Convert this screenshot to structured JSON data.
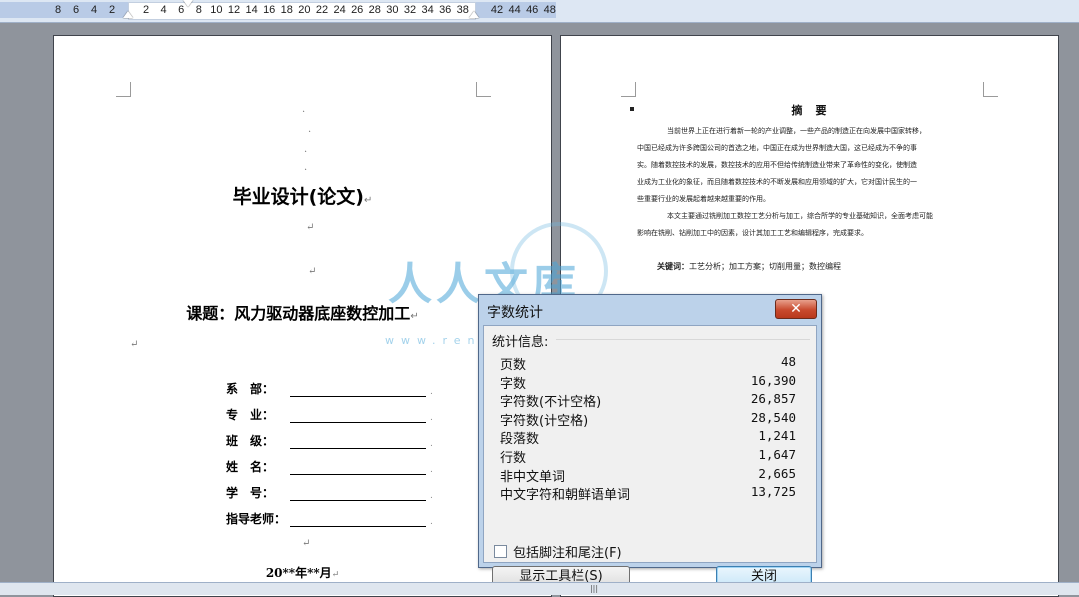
{
  "ruler": {
    "numbers_left": [
      "8",
      "6",
      "4",
      "2"
    ],
    "numbers_right": [
      "2",
      "4",
      "6",
      "8",
      "10",
      "12",
      "14",
      "16",
      "18",
      "20",
      "22",
      "24",
      "26",
      "28",
      "30",
      "32",
      "34",
      "36",
      "38"
    ],
    "numbers_far": [
      "42",
      "44",
      "46",
      "48"
    ]
  },
  "left_page": {
    "title": "毕业设计(论文)",
    "subject": "课题：风力驱动器底座数控加工",
    "fields": [
      {
        "label": "系　部："
      },
      {
        "label": "专　业："
      },
      {
        "label": "班　级："
      },
      {
        "label": "姓　名："
      },
      {
        "label": "学　号："
      },
      {
        "label": "指导老师："
      }
    ],
    "date": "20**年**月",
    "return_mark": "↵"
  },
  "right_page": {
    "abstract_heading": "摘　要",
    "abstract_lines": [
      "当前世界上正在进行着新一轮的产业调整，一些产品的制造正在向发展中国家转移，",
      "中国已经成为许多跨国公司的首选之地，中国正在成为世界制造大国，这已经成为不争的事",
      "实。随着数控技术的发展，数控技术的应用不但给传统制造业带来了革命性的变化，使制造",
      "业成为工业化的象征，而且随着数控技术的不断发展和应用领域的扩大，它对国计民生的一",
      "些重要行业的发展起着越来越重要的作用。",
      "本文主要通过铣削加工数控工艺分析与加工，综合所学的专业基础知识，全面考虑可能",
      "影响在铣削、钻削加工中的因素，设计其加工工艺和编辑程序，完成要求。"
    ],
    "keywords_label": "关键词：",
    "keywords": "工艺分析；加工方案；切削用量；数控编程"
  },
  "watermark": {
    "text": "人人文库",
    "url": "www.renrendoc.com"
  },
  "dialog": {
    "title": "字数统计",
    "close_label": "✕",
    "section_label": "统计信息:",
    "stats": [
      {
        "label": "页数",
        "value": "48"
      },
      {
        "label": "字数",
        "value": "16,390"
      },
      {
        "label": "字符数(不计空格)",
        "value": "26,857"
      },
      {
        "label": "字符数(计空格)",
        "value": "28,540"
      },
      {
        "label": "段落数",
        "value": "1,241"
      },
      {
        "label": "行数",
        "value": "1,647"
      },
      {
        "label": "非中文单词",
        "value": "2,665"
      },
      {
        "label": "中文字符和朝鲜语单词",
        "value": "13,725"
      }
    ],
    "checkbox_label": "包括脚注和尾注(F)",
    "checkbox_checked": false,
    "toolbar_button": "显示工具栏(S)",
    "close_button": "关闭"
  },
  "scrollbar": {
    "grip": "|||"
  }
}
